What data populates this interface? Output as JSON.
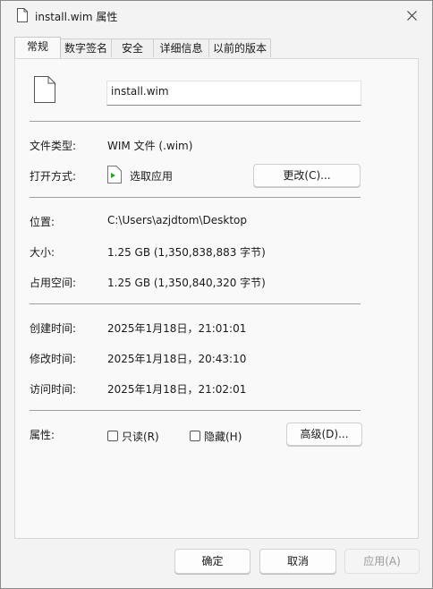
{
  "window": {
    "title": "install.wim 属性"
  },
  "tabs": [
    {
      "label": "常规"
    },
    {
      "label": "数字签名"
    },
    {
      "label": "安全"
    },
    {
      "label": "详细信息"
    },
    {
      "label": "以前的版本"
    }
  ],
  "general": {
    "file_name": "install.wim",
    "type_label": "文件类型:",
    "type_value": "WIM 文件 (.wim)",
    "opens_with_label": "打开方式:",
    "opens_with_value": "选取应用",
    "change_button": "更改(C)...",
    "location_label": "位置:",
    "location_value": "C:\\Users\\azjdtom\\Desktop",
    "size_label": "大小:",
    "size_value": "1.25 GB (1,350,838,883 字节)",
    "size_on_disk_label": "占用空间:",
    "size_on_disk_value": "1.25 GB (1,350,840,320 字节)",
    "created_label": "创建时间:",
    "created_value": "2025年1月18日，21:01:01",
    "modified_label": "修改时间:",
    "modified_value": "2025年1月18日，20:43:10",
    "accessed_label": "访问时间:",
    "accessed_value": "2025年1月18日，21:02:01",
    "attributes_label": "属性:",
    "readonly_label": "只读(R)",
    "readonly_checked": false,
    "hidden_label": "隐藏(H)",
    "hidden_checked": false,
    "advanced_button": "高级(D)..."
  },
  "footer": {
    "ok": "确定",
    "cancel": "取消",
    "apply": "应用(A)"
  }
}
